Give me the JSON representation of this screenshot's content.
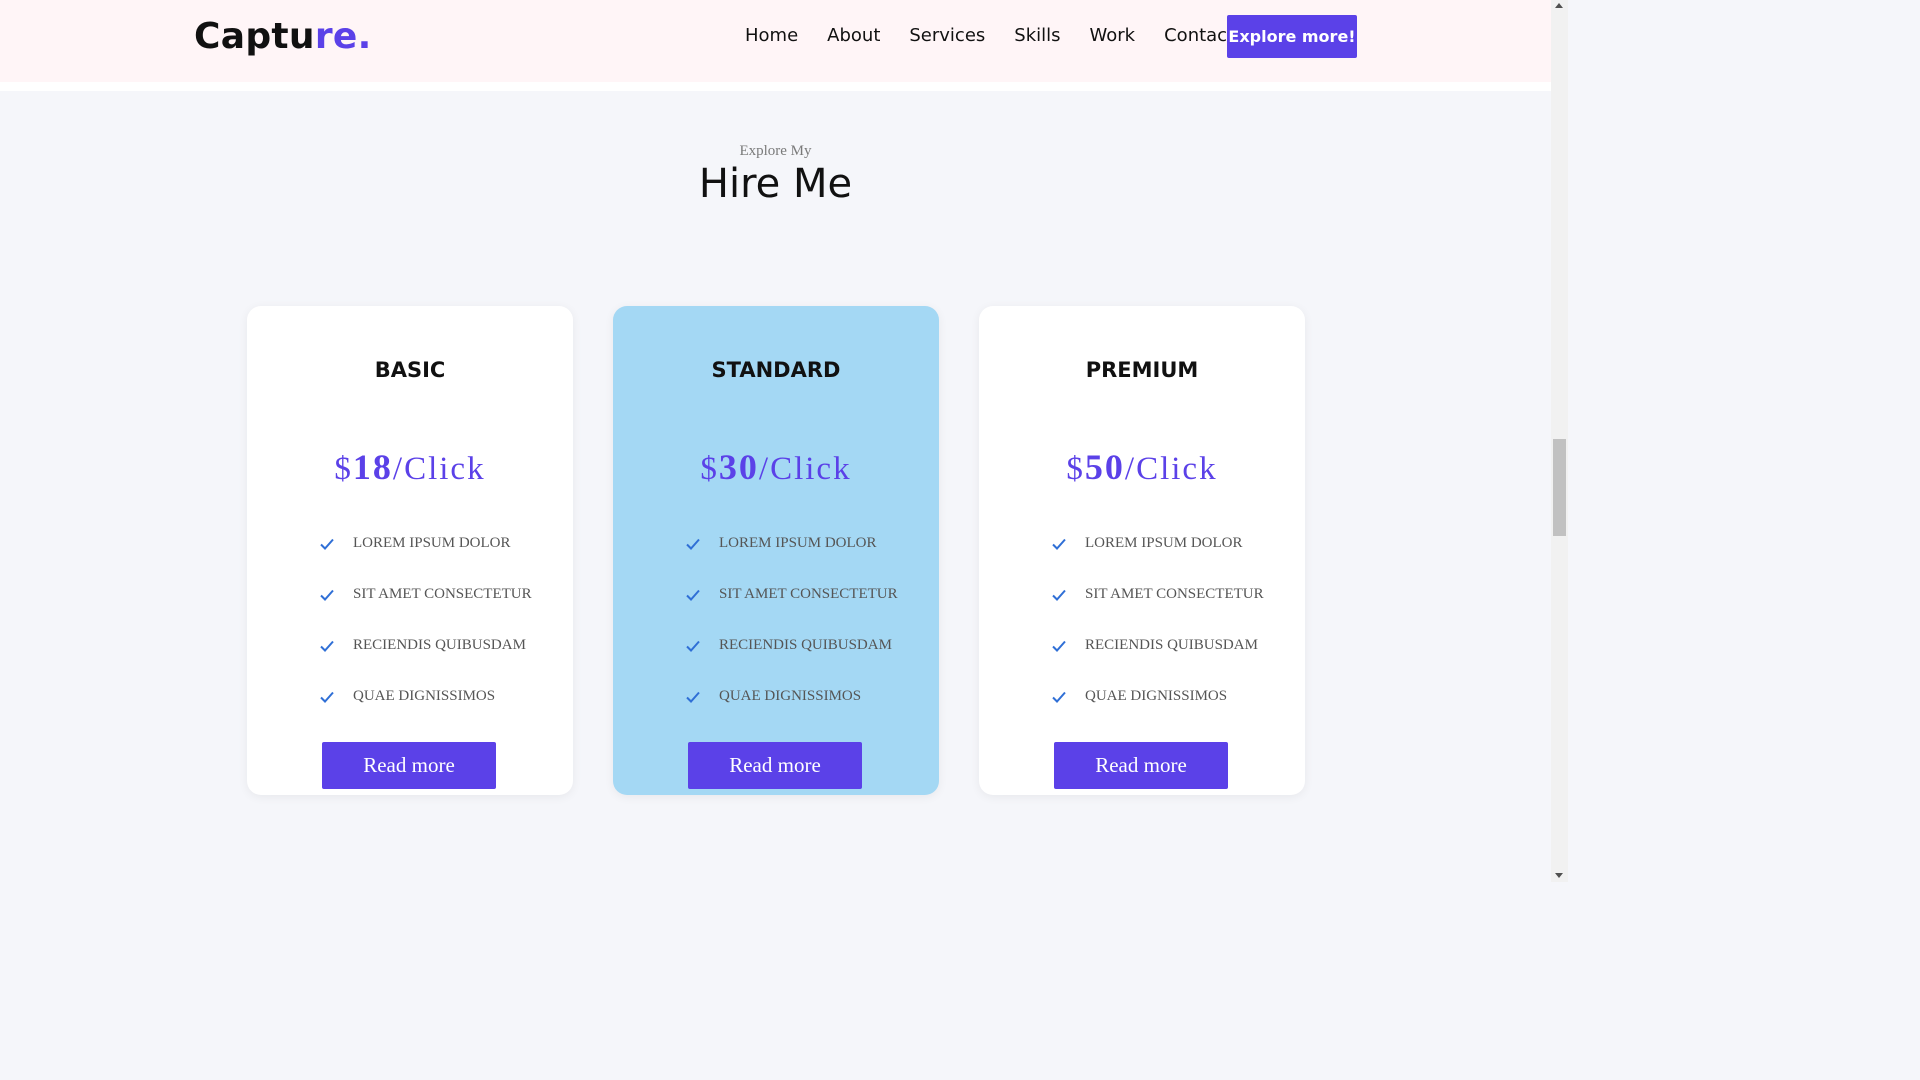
{
  "nav": {
    "logo_main": "Captu",
    "logo_accent": "re.",
    "links": [
      "Home",
      "About",
      "Services",
      "Skills",
      "Work",
      "Contact"
    ],
    "cta_label": "Explore more!"
  },
  "section": {
    "subtitle": "Explore My",
    "title": "Hire Me"
  },
  "plans": [
    {
      "name": "BASIC",
      "currency": "$",
      "amount": "18",
      "unit": "/Click",
      "features": [
        "LOREM IPSUM DOLOR",
        "SIT AMET CONSECTETUR",
        "RECIENDIS QUIBUSDAM",
        "QUAE DIGNISSIMOS"
      ],
      "button_label": "Read more"
    },
    {
      "name": "STANDARD",
      "currency": "$",
      "amount": "30",
      "unit": "/Click",
      "features": [
        "LOREM IPSUM DOLOR",
        "SIT AMET CONSECTETUR",
        "RECIENDIS QUIBUSDAM",
        "QUAE DIGNISSIMOS"
      ],
      "button_label": "Read more"
    },
    {
      "name": "PREMIUM",
      "currency": "$",
      "amount": "50",
      "unit": "/Click",
      "features": [
        "LOREM IPSUM DOLOR",
        "SIT AMET CONSECTETUR",
        "RECIENDIS QUIBUSDAM",
        "QUAE DIGNISSIMOS"
      ],
      "button_label": "Read more"
    }
  ],
  "colors": {
    "accent": "#5b41e8",
    "featured_card": "#a4d8f4",
    "check": "#2f6fd6"
  },
  "icons": {
    "feature_bullet": "check-icon"
  }
}
